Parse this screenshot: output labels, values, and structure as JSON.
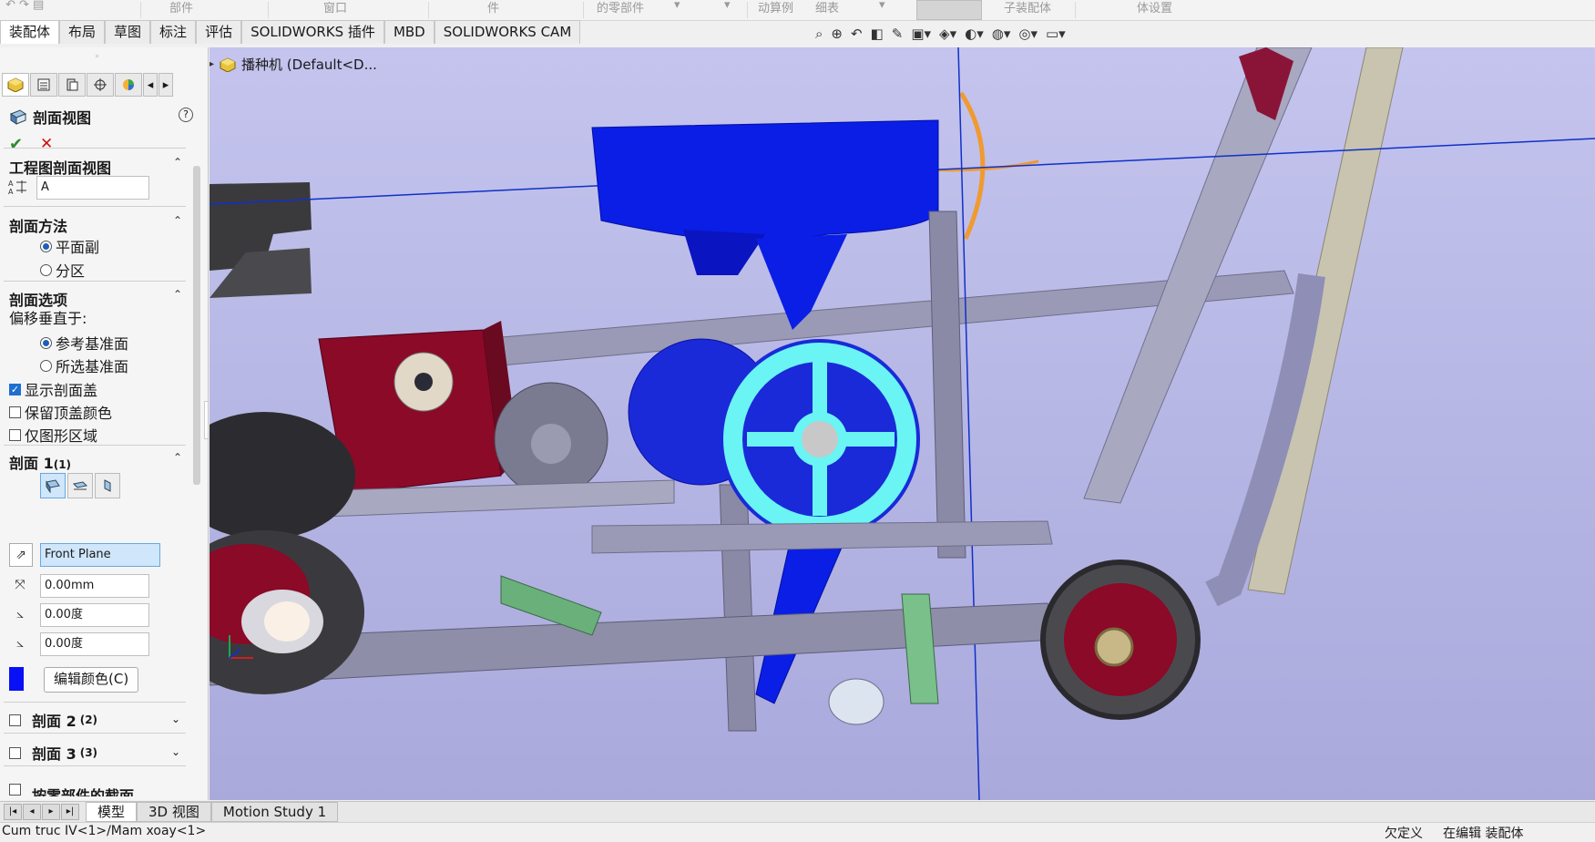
{
  "ribbon_strip": {
    "labels": [
      "部件",
      "窗口",
      "件",
      "的零部件",
      "动算例",
      "细表",
      "子装配体",
      "体设置"
    ]
  },
  "tabs": [
    "装配体",
    "布局",
    "草图",
    "标注",
    "评估",
    "SOLIDWORKS 插件",
    "MBD",
    "SOLIDWORKS CAM"
  ],
  "left_panel": {
    "title": "剖面视图",
    "help": "?",
    "section_drawing": {
      "heading": "工程图剖面视图",
      "name_value": "A"
    },
    "section_method": {
      "heading": "剖面方法",
      "options": [
        "平面副",
        "分区"
      ],
      "selected": "平面副"
    },
    "section_options": {
      "heading": "剖面选项",
      "offset_label": "偏移垂直于:",
      "offset_options": [
        "参考基准面",
        "所选基准面"
      ],
      "offset_selected": "参考基准面",
      "checkboxes": [
        {
          "label": "显示剖面盖",
          "checked": true
        },
        {
          "label": "保留顶盖颜色",
          "checked": false
        },
        {
          "label": "仅图形区域",
          "checked": false
        }
      ]
    },
    "section1": {
      "heading": "剖面 1",
      "heading_count": "(1)",
      "plane_value": "Front Plane",
      "distance_value": "0.00mm",
      "angle1_value": "0.00度",
      "angle2_value": "0.00度",
      "edit_color_label": "编辑颜色(C)",
      "cap_color": "#0a10f5"
    },
    "section2": {
      "heading": "剖面 2",
      "count": "(2)",
      "checked": false
    },
    "section3": {
      "heading": "剖面 3",
      "count": "(3)",
      "checked": false
    },
    "section4_partial": "按零部件的截面"
  },
  "viewport": {
    "tree_root": "播种机 (Default<D..."
  },
  "bottom_tabs": [
    "模型",
    "3D 视图",
    "Motion Study 1"
  ],
  "bottom_tab_active": "模型",
  "status_bar": {
    "left": "Cum truc IV<1>/Mam xoay<1>",
    "right1": "欠定义",
    "right2": "在编辑 装配体"
  },
  "colors": {
    "background": "#b9b9e6",
    "hopper": "#0a1ee6",
    "seed_plate": "#6af4f4",
    "gearbox": "#8a0a28"
  }
}
